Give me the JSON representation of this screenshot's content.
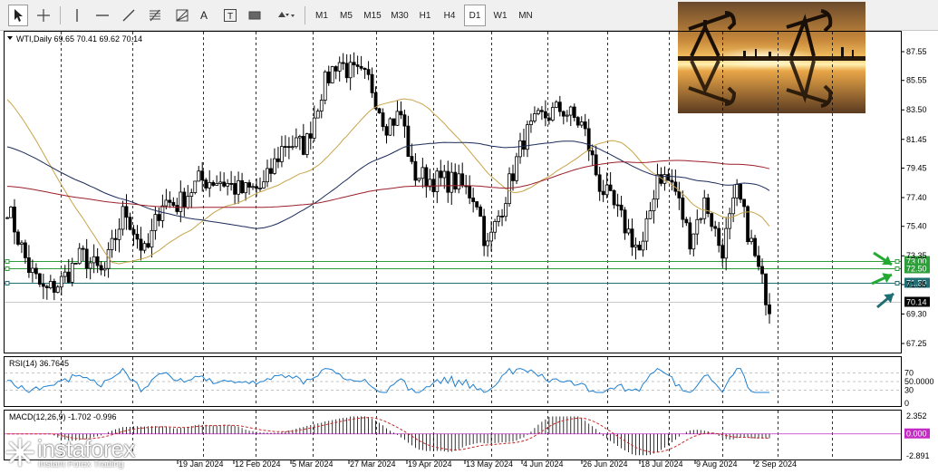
{
  "toolbar": {
    "timeframes": [
      "M1",
      "M5",
      "M15",
      "M30",
      "H1",
      "H4",
      "D1",
      "W1",
      "MN"
    ],
    "active_timeframe": "D1",
    "tools": [
      "cursor-icon",
      "crosshair-icon",
      "vertical-line-icon",
      "horizontal-line-icon",
      "trendline-icon",
      "fibonacci-icon",
      "fibo-fan-icon",
      "text-icon",
      "label-icon",
      "rectangle-icon",
      "shapes-menu-icon"
    ],
    "text_tool_label": "A",
    "label_tool_label": "T"
  },
  "main_chart": {
    "header": "WTI,Daily  69.65 70.41 69.62 70.14",
    "price_labels": [
      "87.55",
      "85.55",
      "83.50",
      "81.45",
      "79.45",
      "77.40",
      "75.40",
      "73.35",
      "71.35",
      "69.30",
      "67.25"
    ],
    "levels": [
      {
        "value": 73.0,
        "label": "73.00",
        "color": "#2e9e3a"
      },
      {
        "value": 72.5,
        "label": "72.50",
        "color": "#2e9e3a"
      },
      {
        "value": 71.5,
        "label": "71.50",
        "color": "#1f6e74"
      }
    ],
    "current_price_label": "70.14",
    "y_range": [
      66.6,
      88.8
    ],
    "date_labels": [
      "19 Jan 2024",
      "12 Feb 2024",
      "5 Mar 2024",
      "27 Mar 2024",
      "19 Apr 2024",
      "13 May 2024",
      "4 Jun 2024",
      "26 Jun 2024",
      "18 Jul 2024",
      "9 Aug 2024",
      "2 Sep 2024"
    ],
    "colors": {
      "bull": "#000000",
      "ma_fast": "#c8a44a",
      "ma_mid": "#1c2b5a",
      "ma_slow": "#9c1f2a",
      "arrow_green": "#22aa33",
      "arrow_teal": "#1f6e74"
    }
  },
  "rsi": {
    "header": "RSI(14) 36.7645",
    "labels": [
      "70",
      "50.0000",
      "30",
      "0"
    ],
    "color": "#1e7fd0"
  },
  "macd": {
    "header": "MACD(12,26,9) -1.702 -0.996",
    "labels": [
      "2.352",
      "0.000",
      "-2.891"
    ]
  },
  "logo": {
    "brand": "instaforex",
    "tagline": "Instant Forex Trading"
  }
}
